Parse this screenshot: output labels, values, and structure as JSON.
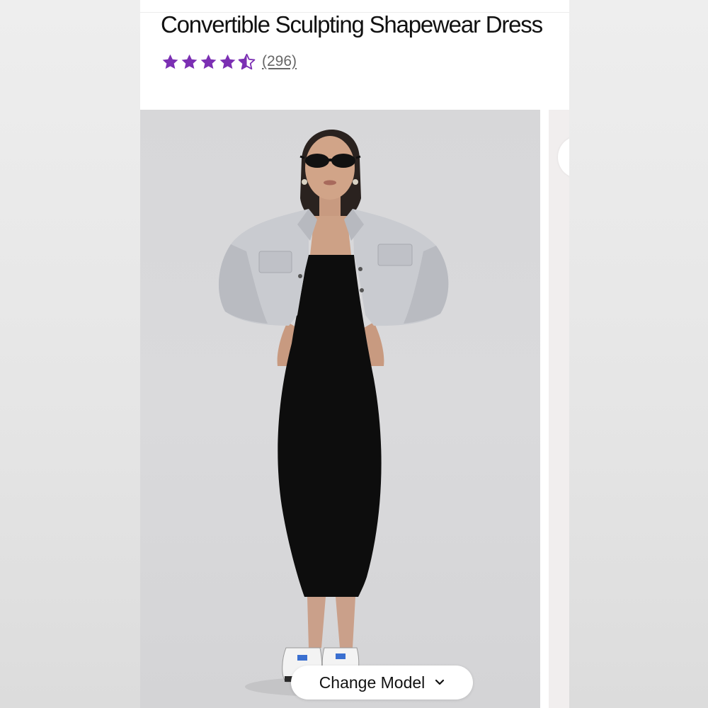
{
  "product": {
    "title": "Convertible Sculpting Shapewear Dress",
    "rating": {
      "stars": 4.5,
      "max": 5,
      "review_count": "(296)"
    }
  },
  "gallery": {
    "main_image": "model-photo",
    "change_model_label": "Change Model",
    "change_model_icon": "chevron-down-icon"
  },
  "colors": {
    "star": "#7b2fb3",
    "panel": "#ffffff",
    "background": "#e7e7e7"
  }
}
